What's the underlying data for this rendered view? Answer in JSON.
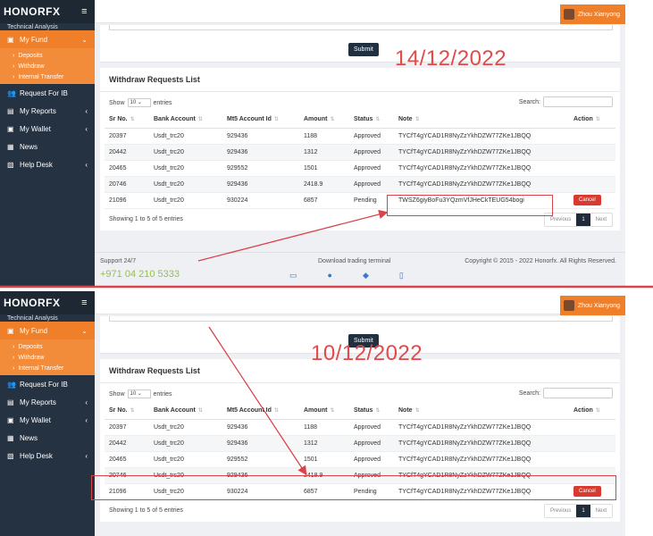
{
  "brand": "HONORFX",
  "user_name": "Zhou Xianyong",
  "sidebar": {
    "faded_item": "Technical Analysis",
    "my_fund": "My Fund",
    "sub_items": [
      "Deposits",
      "Withdraw",
      "Internal Transfer"
    ],
    "request_ib": "Request For IB",
    "my_reports": "My Reports",
    "my_wallet": "My Wallet",
    "news": "News",
    "help_desk": "Help Desk"
  },
  "submit_label": "Submit",
  "card_title": "Withdraw Requests List",
  "show_label": "Show",
  "entries_value": "10",
  "entries_label": "entries",
  "search_label": "Search:",
  "columns": [
    "Sr No.",
    "Bank Account",
    "Mt5 Account Id",
    "Amount",
    "Status",
    "Note",
    "Action"
  ],
  "info": "Showing 1 to 5 of 5 entries",
  "pager": {
    "prev": "Previous",
    "page": "1",
    "next": "Next"
  },
  "cancel_label": "Cancel",
  "footer": {
    "support": "Support 24/7",
    "phone": "+971 04 210 5333",
    "download": "Download trading terminal",
    "copyright": "Copyright © 2015 - 2022 Honorfx. All Rights Reserved."
  },
  "top": {
    "date": "14/12/2022",
    "rows": [
      {
        "sr": "20397",
        "bank": "Usdt_trc20",
        "mt5": "929436",
        "amount": "1188",
        "status": "Approved",
        "note": "TYCfT4gYCAD1R8NyZzYkhDZW77ZKe1JBQQ"
      },
      {
        "sr": "20442",
        "bank": "Usdt_trc20",
        "mt5": "929436",
        "amount": "1312",
        "status": "Approved",
        "note": "TYCfT4gYCAD1R8NyZzYkhDZW77ZKe1JBQQ"
      },
      {
        "sr": "20465",
        "bank": "Usdt_trc20",
        "mt5": "929552",
        "amount": "1501",
        "status": "Approved",
        "note": "TYCfT4gYCAD1R8NyZzYkhDZW77ZKe1JBQQ"
      },
      {
        "sr": "20746",
        "bank": "Usdt_trc20",
        "mt5": "929436",
        "amount": "2418.9",
        "status": "Approved",
        "note": "TYCfT4gYCAD1R8NyZzYkhDZW77ZKe1JBQQ"
      },
      {
        "sr": "21096",
        "bank": "Usdt_trc20",
        "mt5": "930224",
        "amount": "6857",
        "status": "Pending",
        "note": "TWSZ6giyBoFu3YQzmVfJHeCkTEUG54bogi"
      }
    ]
  },
  "bottom": {
    "date": "10/12/2022",
    "rows": [
      {
        "sr": "20397",
        "bank": "Usdt_trc20",
        "mt5": "929436",
        "amount": "1188",
        "status": "Approved",
        "note": "TYCfT4gYCAD1R8NyZzYkhDZW77ZKe1JBQQ"
      },
      {
        "sr": "20442",
        "bank": "Usdt_trc20",
        "mt5": "929436",
        "amount": "1312",
        "status": "Approved",
        "note": "TYCfT4gYCAD1R8NyZzYkhDZW77ZKe1JBQQ"
      },
      {
        "sr": "20465",
        "bank": "Usdt_trc20",
        "mt5": "929552",
        "amount": "1501",
        "status": "Approved",
        "note": "TYCfT4gYCAD1R8NyZzYkhDZW77ZKe1JBQQ"
      },
      {
        "sr": "20746",
        "bank": "Usdt_trc20",
        "mt5": "929436",
        "amount": "2418.9",
        "status": "Approved",
        "note": "TYCfT4gYCAD1R8NyZzYkhDZW77ZKe1JBQQ"
      },
      {
        "sr": "21096",
        "bank": "Usdt_trc20",
        "mt5": "930224",
        "amount": "6857",
        "status": "Pending",
        "note": "TYCfT4gYCAD1R8NyZzYkhDZW77ZKe1JBQQ"
      }
    ]
  },
  "colors": {
    "accent": "#f07f2a",
    "sidebar": "#253241",
    "annotation": "#e24a4a",
    "cancel": "#d93a2f"
  }
}
